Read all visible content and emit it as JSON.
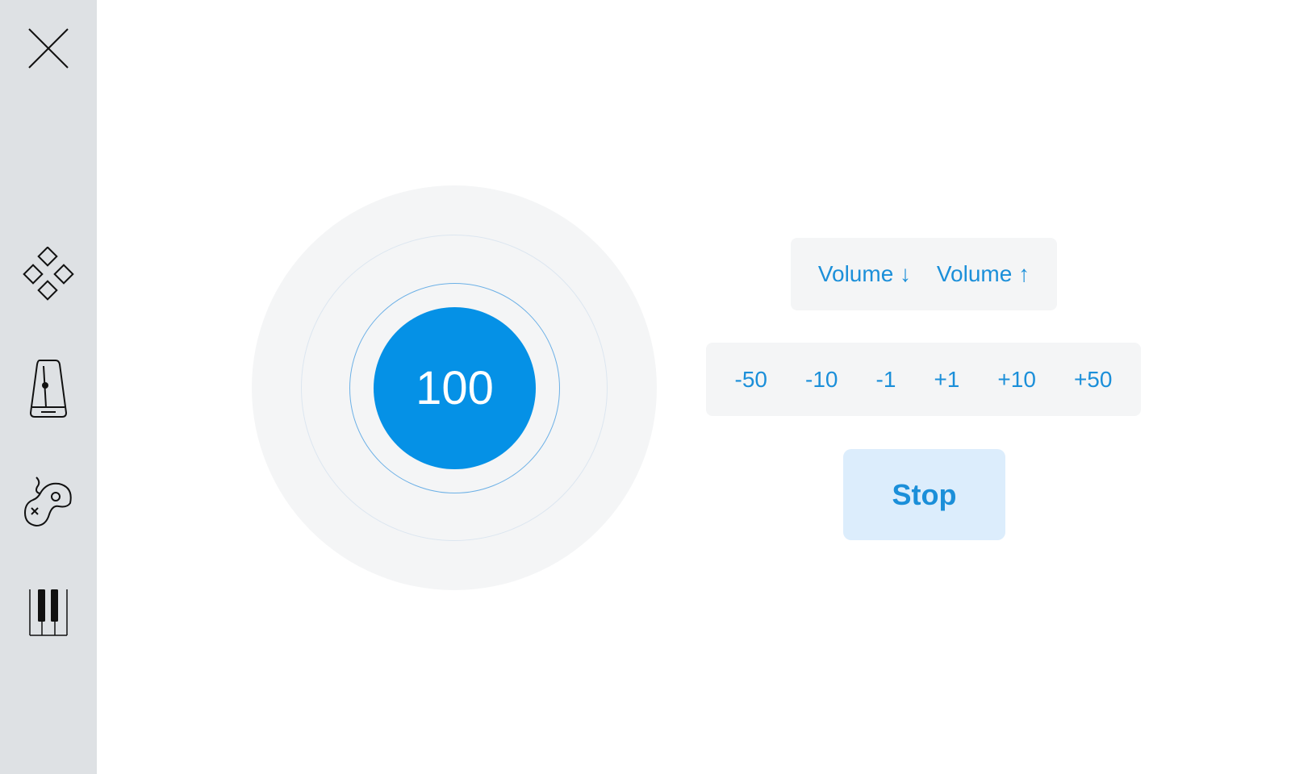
{
  "sidebar": {
    "close": {
      "icon": "close-icon"
    },
    "items": [
      {
        "id": "dpad",
        "icon": "dpad-icon"
      },
      {
        "id": "metronome",
        "icon": "metronome-icon"
      },
      {
        "id": "games",
        "icon": "gamepad-icon"
      },
      {
        "id": "piano",
        "icon": "piano-icon"
      }
    ]
  },
  "metronome": {
    "tempo": "100"
  },
  "volume": {
    "down_label": "Volume ↓",
    "up_label": "Volume ↑"
  },
  "steps": [
    "-50",
    "-10",
    "-1",
    "+1",
    "+10",
    "+50"
  ],
  "stop_label": "Stop",
  "colors": {
    "accent": "#0591e6",
    "text_accent": "#1b8fd9",
    "sidebar_bg": "#dee1e4",
    "panel_bg": "#f4f5f6",
    "stop_bg": "#dcedfc"
  }
}
